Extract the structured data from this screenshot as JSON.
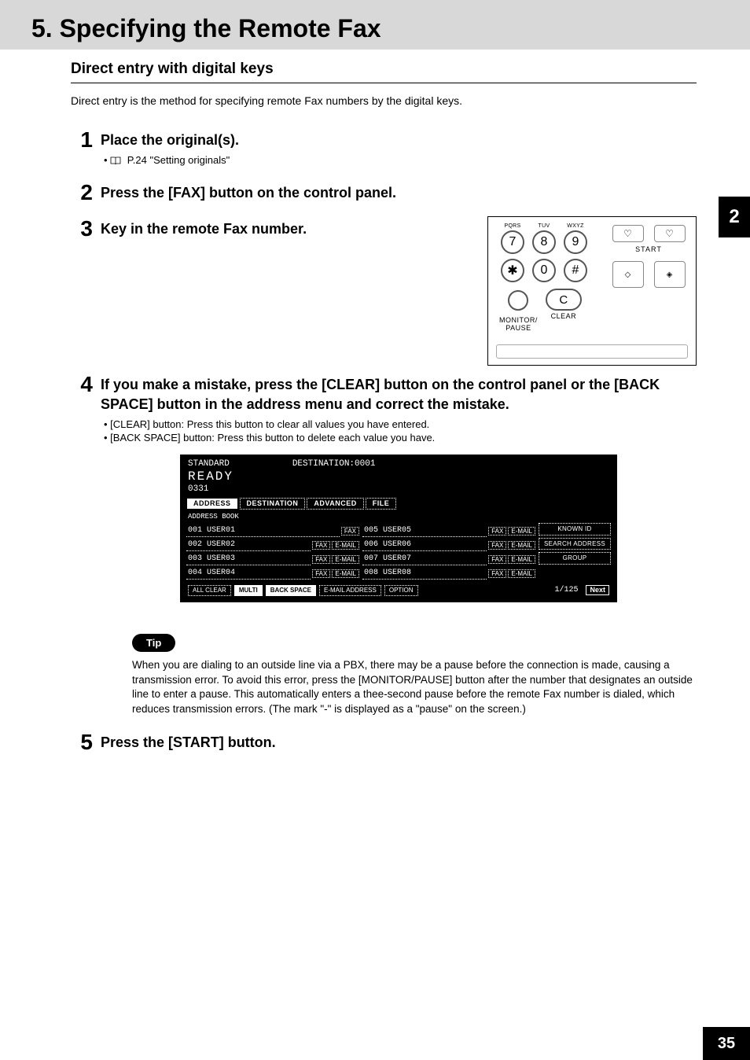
{
  "header": {
    "chapter": "5. Specifying the Remote Fax"
  },
  "subhead": "Direct entry with digital keys",
  "intro": "Direct entry is the method for specifying remote Fax numbers by the digital keys.",
  "side_tab": "2",
  "steps": {
    "s1": {
      "num": "1",
      "title": "Place the original(s).",
      "ref": "P.24 \"Setting originals\""
    },
    "s2": {
      "num": "2",
      "title": "Press the [FAX] button on the control panel."
    },
    "s3": {
      "num": "3",
      "title": "Key in the remote Fax number."
    },
    "s4": {
      "num": "4",
      "title": "If you make a mistake, press the [CLEAR] button on the control panel or the [BACK SPACE] button in the address menu and correct the mistake.",
      "b1": "[CLEAR] button: Press this button to clear all values you have entered.",
      "b2": "[BACK SPACE] button: Press this button to delete each value you have."
    },
    "s5": {
      "num": "5",
      "title": "Press the [START] button."
    }
  },
  "keypad": {
    "labels": {
      "pqrs": "PQRS",
      "tuv": "TUV",
      "wxyz": "WXYZ"
    },
    "keys": {
      "k7": "7",
      "k8": "8",
      "k9": "9",
      "kstar": "✱",
      "k0": "0",
      "khash": "#",
      "kC": "C"
    },
    "bottom": {
      "monitor": "MONITOR/\nPAUSE",
      "clear": "CLEAR"
    },
    "start": "START"
  },
  "panel": {
    "top": {
      "mode": "STANDARD",
      "dest": "DESTINATION:0001",
      "ready": "READY",
      "number": "0331"
    },
    "tabs": {
      "address": "ADDRESS",
      "destination": "DESTINATION",
      "advanced": "ADVANCED",
      "file": "FILE"
    },
    "label": "ADDRESS BOOK",
    "left": [
      {
        "name": "001 USER01",
        "fax": "FAX"
      },
      {
        "name": "002 USER02",
        "fax": "FAX",
        "em": "E-MAIL"
      },
      {
        "name": "003 USER03",
        "fax": "FAX",
        "em": "E-MAIL"
      },
      {
        "name": "004 USER04",
        "fax": "FAX",
        "em": "E-MAIL"
      }
    ],
    "right": [
      {
        "name": "005 USER05",
        "fax": "FAX",
        "em": "E-MAIL"
      },
      {
        "name": "006 USER06",
        "fax": "FAX",
        "em": "E-MAIL"
      },
      {
        "name": "007 USER07",
        "fax": "FAX",
        "em": "E-MAIL"
      },
      {
        "name": "008 USER08",
        "fax": "FAX",
        "em": "E-MAIL"
      }
    ],
    "side": {
      "known": "KNOWN ID",
      "search": "SEARCH ADDRESS",
      "group": "GROUP"
    },
    "bottom": {
      "allclear": "ALL CLEAR",
      "multi": "MULTI",
      "back": "BACK SPACE",
      "emailaddr": "E-MAIL ADDRESS",
      "option": "OPTION",
      "page": "1/125",
      "next": "Next"
    }
  },
  "tip": {
    "badge": "Tip",
    "text": "When you are dialing to an outside line via a PBX, there may be a pause before the connection is made, causing a transmission error. To avoid this error, press the [MONITOR/PAUSE] button after the number that designates an outside line to enter a pause. This automatically enters a thee-second pause before the remote Fax number is dialed, which reduces transmission errors. (The mark \"-\" is displayed as a \"pause\" on the screen.)"
  },
  "page_number": "35"
}
